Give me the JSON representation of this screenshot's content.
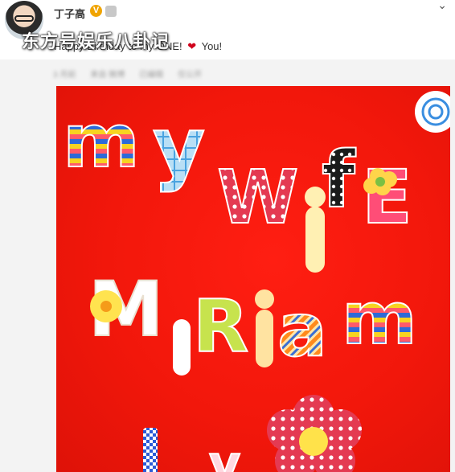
{
  "post": {
    "author": "丁子高",
    "verified_badge": "V",
    "watermark": "东方号娱乐八卦记",
    "text_before": "Happy Birthday to my ONE!",
    "text_after": "You!",
    "heart_symbol": "❤",
    "meta": [
      "3 月前",
      "来自 微博",
      "已编辑",
      "仅公开"
    ]
  },
  "photo": {
    "line1": "my",
    "line2": "Wife",
    "line3": "Miriam",
    "background_color": "#ef1a0e"
  },
  "icons": {
    "chevron": "chevron-down-icon",
    "avatar": "avatar"
  }
}
